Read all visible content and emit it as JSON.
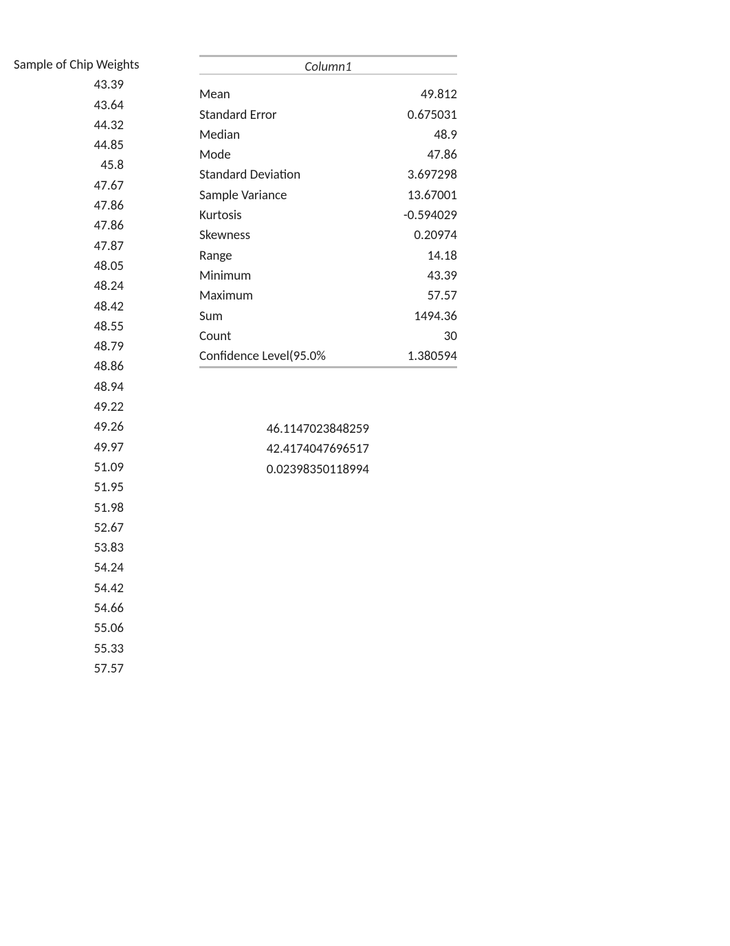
{
  "sample": {
    "header": "Sample of Chip Weights",
    "values": [
      "43.39",
      "43.64",
      "44.32",
      "44.85",
      "45.8",
      "47.67",
      "47.86",
      "47.86",
      "47.87",
      "48.05",
      "48.24",
      "48.42",
      "48.55",
      "48.79",
      "48.86",
      "48.94",
      "49.22",
      "49.26",
      "49.97",
      "51.09",
      "51.95",
      "51.98",
      "52.67",
      "53.83",
      "54.24",
      "54.42",
      "54.66",
      "55.06",
      "55.33",
      "57.57"
    ]
  },
  "stats": {
    "title": "Column1",
    "rows": [
      {
        "label": "Mean",
        "value": "49.812"
      },
      {
        "label": "Standard Error",
        "value": "0.675031"
      },
      {
        "label": "Median",
        "value": "48.9"
      },
      {
        "label": "Mode",
        "value": "47.86"
      },
      {
        "label": "Standard Deviation",
        "value": "3.697298"
      },
      {
        "label": "Sample Variance",
        "value": "13.67001"
      },
      {
        "label": "Kurtosis",
        "value": "-0.594029"
      },
      {
        "label": "Skewness",
        "value": "0.20974"
      },
      {
        "label": "Range",
        "value": "14.18"
      },
      {
        "label": "Minimum",
        "value": "43.39"
      },
      {
        "label": "Maximum",
        "value": "57.57"
      },
      {
        "label": "Sum",
        "value": "1494.36"
      },
      {
        "label": "Count",
        "value": "30"
      },
      {
        "label": "Confidence Level(95.0%",
        "value": "1.380594"
      }
    ]
  },
  "extra": {
    "values": [
      "46.1147023848259",
      "42.4174047696517",
      "0.02398350118994"
    ]
  },
  "chart_data": {
    "type": "table",
    "title": "Column1",
    "sample_header": "Sample of Chip Weights",
    "sample_values": [
      43.39,
      43.64,
      44.32,
      44.85,
      45.8,
      47.67,
      47.86,
      47.86,
      47.87,
      48.05,
      48.24,
      48.42,
      48.55,
      48.79,
      48.86,
      48.94,
      49.22,
      49.26,
      49.97,
      51.09,
      51.95,
      51.98,
      52.67,
      53.83,
      54.24,
      54.42,
      54.66,
      55.06,
      55.33,
      57.57
    ],
    "descriptive_statistics": {
      "Mean": 49.812,
      "Standard Error": 0.675031,
      "Median": 48.9,
      "Mode": 47.86,
      "Standard Deviation": 3.697298,
      "Sample Variance": 13.67001,
      "Kurtosis": -0.594029,
      "Skewness": 0.20974,
      "Range": 14.18,
      "Minimum": 43.39,
      "Maximum": 57.57,
      "Sum": 1494.36,
      "Count": 30,
      "Confidence Level(95.0%)": 1.380594
    },
    "extra_values": [
      46.1147023848259,
      42.4174047696517,
      0.02398350118994
    ]
  }
}
